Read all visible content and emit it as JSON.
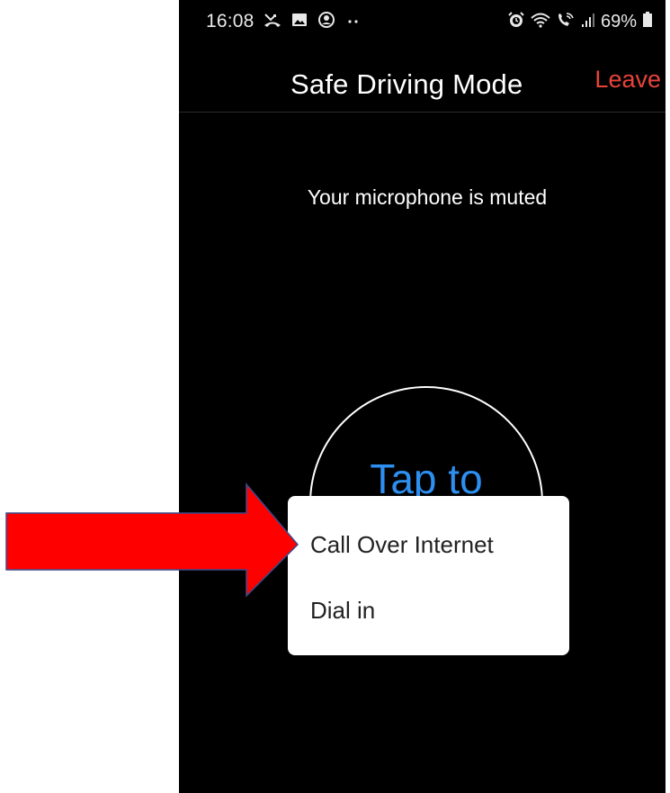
{
  "status_bar": {
    "time": "16:08",
    "battery": "69%",
    "icons_left": [
      "missed-call-icon",
      "image-icon",
      "face-icon",
      "more-dots-icon"
    ],
    "icons_right": [
      "alarm-icon",
      "wifi-icon",
      "wifi-call-icon",
      "signal-icon",
      "battery-icon"
    ]
  },
  "header": {
    "title": "Safe Driving Mode",
    "leave_label": "Leave"
  },
  "main": {
    "muted_message": "Your microphone is muted",
    "tap_label": "Tap to"
  },
  "popup_menu": {
    "items": [
      {
        "label": "Call Over Internet"
      },
      {
        "label": "Dial in"
      }
    ]
  },
  "annotation": {
    "arrow_color": "#ff0000",
    "arrow_outline": "#3a4a8a"
  },
  "colors": {
    "background": "#000000",
    "leave": "#e8433b",
    "tap_text": "#2d8ff0"
  }
}
